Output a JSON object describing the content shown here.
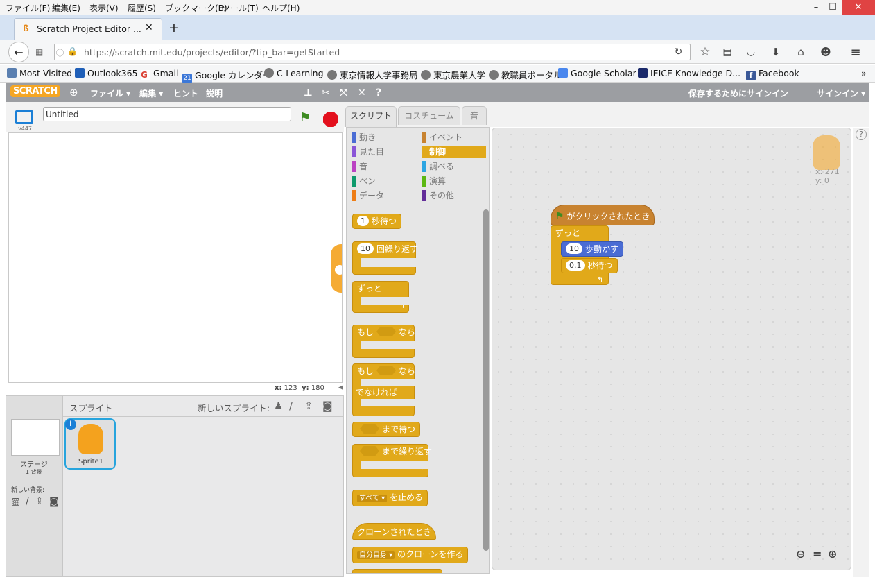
{
  "menu": {
    "items": [
      "ファイル(F)",
      "編集(E)",
      "表示(V)",
      "履歴(S)",
      "ブックマーク(B)",
      "ツール(T)",
      "ヘルプ(H)"
    ]
  },
  "browser": {
    "tab_title": "Scratch Project Editor ...",
    "url": "https://scratch.mit.edu/projects/editor/?tip_bar=getStarted",
    "bookmarks": [
      "Most Visited",
      "Outlook365",
      "Gmail",
      "Google カレンダー",
      "C-Learning",
      "東京情報大学事務局",
      "東京農業大学",
      "教職員ポータル",
      "Google Scholar",
      "IEICE Knowledge D...",
      "Facebook"
    ],
    "new_tab": "+",
    "more": "»"
  },
  "scratch": {
    "logo": "SCRATCH",
    "menu": [
      "ファイル ▾",
      "編集 ▾",
      "ヒント",
      "説明"
    ],
    "save_signin": "保存するためにサインイン",
    "signin": "サインイン ▾",
    "project_title": "Untitled",
    "version": "v447",
    "coords": {
      "x_label": "x:",
      "x": "123",
      "y_label": "y:",
      "y": "180"
    },
    "sprite_panel": {
      "title": "スプライト",
      "new_sprite": "新しいスプライト:",
      "stage_label": "ステージ",
      "backdrop_count": "1 背景",
      "new_backdrop": "新しい背景:",
      "sprite_name": "Sprite1"
    },
    "tabs": [
      "スクリプト",
      "コスチューム",
      "音"
    ],
    "categories_left": [
      "動き",
      "見た目",
      "音",
      "ペン",
      "データ"
    ],
    "categories_right": [
      "イベント",
      "制御",
      "調べる",
      "演算",
      "その他"
    ],
    "palette": {
      "wait_num": "1",
      "wait_text": "秒待つ",
      "repeat_num": "10",
      "repeat_text": "回繰り返す",
      "forever": "ずっと",
      "if": "もし",
      "then": "なら",
      "else": "でなければ",
      "wait_until": "まで待つ",
      "repeat_until": "まで繰り返す",
      "stop_opt": "すべて ▾",
      "stop_text": "を止める",
      "clone_start": "クローンされたとき",
      "clone_opt": "自分自身 ▾",
      "clone_text": "のクローンを作る"
    },
    "script": {
      "hat": "がクリックされたとき",
      "forever": "ずっと",
      "move_num": "10",
      "move_text": "歩動かす",
      "wait_num": "0.1",
      "wait_text": "秒待つ"
    },
    "sprite_info": {
      "x": "x: 271",
      "y": "y: 0"
    },
    "zoom": [
      "zoom-out",
      "reset",
      "zoom-in"
    ]
  },
  "colors": {
    "control": "#e1a91a",
    "motion": "#4a6cd4",
    "events": "#c88330"
  }
}
